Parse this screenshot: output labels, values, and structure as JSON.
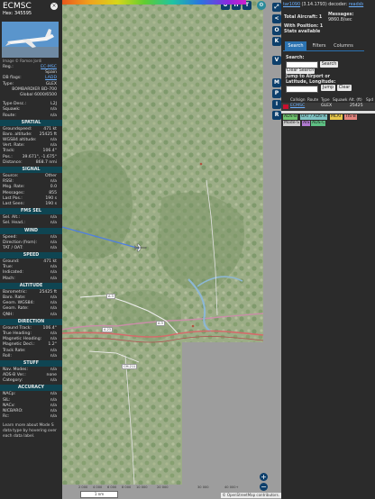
{
  "left_panel": {
    "registration": "ECMSC",
    "hex_line": "Hex: 345595",
    "photo_credit": "Image © Ramon Jordi",
    "close_label": "×",
    "ident_rows": [
      {
        "k": "Reg.:",
        "v": "EC-MSC",
        "link": true
      },
      {
        "k": "",
        "v": "Spain",
        "link": false
      },
      {
        "k": "DB flags:",
        "v": "LADD",
        "link": true
      },
      {
        "k": "Type:",
        "v": "GLEX",
        "link": false
      },
      {
        "k": "",
        "v": "BOMBARDIER BD-700",
        "link": false
      },
      {
        "k": "",
        "v": "Global 6000/6500",
        "link": false
      }
    ],
    "misc_rows": [
      {
        "k": "Type Desc.:",
        "v": "L2J"
      },
      {
        "k": "Squawk:",
        "v": "n/a"
      },
      {
        "k": "Route:",
        "v": "n/a"
      }
    ],
    "sections": [
      {
        "title": "SPATIAL",
        "rows": [
          {
            "k": "Groundspeed:",
            "v": "471 kt"
          },
          {
            "k": "Baro. altitude:",
            "v": "25425 ft"
          },
          {
            "k": "WGS84 altitude:",
            "v": "n/a"
          },
          {
            "k": "Vert. Rate:",
            "v": "n/a"
          },
          {
            "k": "Track:",
            "v": "106.4°"
          },
          {
            "k": "Pos.:",
            "v": "39.671°, -1.675°"
          },
          {
            "k": "Distance:",
            "v": "868.7 nmi"
          }
        ]
      },
      {
        "title": "SIGNAL",
        "rows": [
          {
            "k": "Source:",
            "v": "Other"
          },
          {
            "k": "RSSI:",
            "v": "n/a"
          },
          {
            "k": "Msg. Rate:",
            "v": "0.0"
          },
          {
            "k": "Messages:",
            "v": "855"
          },
          {
            "k": "Last Pos.:",
            "v": "190 s"
          },
          {
            "k": "Last Seen:",
            "v": "190 s"
          }
        ]
      },
      {
        "title": "FMS SEL",
        "rows": [
          {
            "k": "Sel. Alt.:",
            "v": "n/a"
          },
          {
            "k": "Sel. Head.:",
            "v": "n/a"
          }
        ]
      },
      {
        "title": "WIND",
        "rows": [
          {
            "k": "Speed:",
            "v": "n/a"
          },
          {
            "k": "Direction (from):",
            "v": "n/a"
          },
          {
            "k": "TAT / OAT:",
            "v": "n/a"
          }
        ]
      },
      {
        "title": "SPEED",
        "rows": [
          {
            "k": "Ground:",
            "v": "471 kt"
          },
          {
            "k": "True:",
            "v": "n/a"
          },
          {
            "k": "Indicated:",
            "v": "n/a"
          },
          {
            "k": "Mach:",
            "v": "n/a"
          }
        ]
      },
      {
        "title": "ALTITUDE",
        "rows": [
          {
            "k": "Barometric:",
            "v": "25425 ft"
          },
          {
            "k": "Baro. Rate:",
            "v": "n/a"
          },
          {
            "k": "Geom. WGS84:",
            "v": "n/a"
          },
          {
            "k": "Geom. Rate:",
            "v": "n/a"
          },
          {
            "k": "QNH:",
            "v": "n/a"
          }
        ]
      },
      {
        "title": "DIRECTION",
        "rows": [
          {
            "k": "Ground Track:",
            "v": "106.4°"
          },
          {
            "k": "True Heading:",
            "v": "n/a"
          },
          {
            "k": "Magnetic Heading:",
            "v": "n/a"
          },
          {
            "k": "Magnetic Decl.:",
            "v": "1.2°"
          },
          {
            "k": "Track Rate:",
            "v": "n/a"
          },
          {
            "k": "Roll:",
            "v": "n/a"
          }
        ]
      },
      {
        "title": "STUFF",
        "rows": [
          {
            "k": "Nav. Modes:",
            "v": "n/a"
          },
          {
            "k": "ADS-B Ver.:",
            "v": "none"
          },
          {
            "k": "Category:",
            "v": "n/a"
          }
        ]
      },
      {
        "title": "ACCURACY",
        "rows": [
          {
            "k": "NACp:",
            "v": "n/a"
          },
          {
            "k": "SIL:",
            "v": "n/a"
          },
          {
            "k": "NACv:",
            "v": "n/a"
          },
          {
            "k": "NICBARO:",
            "v": "n/a"
          },
          {
            "k": "Rc:",
            "v": "n/a"
          }
        ]
      }
    ],
    "note": "Learn more about Mode S data type by hovering over each data label."
  },
  "map": {
    "top_buttons": [
      "U",
      "H",
      "T"
    ],
    "side_buttons": [
      "<",
      "O",
      "K",
      "V",
      "M",
      "P",
      "I",
      "R"
    ],
    "zoom_in": "+",
    "zoom_out": "−",
    "scale_label": "1 nm",
    "attribution": "© OpenStreetMap contributors.",
    "altitude_legend": [
      "2 000",
      "4 000",
      "6 000",
      "8 000",
      "10 000",
      "20 000",
      "30 000",
      "40 000+"
    ],
    "town_labels": [
      "A-3",
      "A-3",
      "A-23",
      "CM-211"
    ]
  },
  "right_panel": {
    "title_link": "tar1090",
    "version": "(3.14.1793)",
    "decoder_prefix": "decoder:",
    "decoder_link": "readsb",
    "total_aircraft": "Total Aircraft: 1",
    "with_position": "With Position: 1",
    "stats_available": "Stats available",
    "messages_label": "Messages:",
    "messages_rate": "9860.8/sec",
    "tabs": [
      "Search",
      "Filters",
      "Columns"
    ],
    "search_label": "Search:",
    "search_button": "Search",
    "clear_search_button": "Clear Search",
    "jump_label": "Jump to Airport or Latitude, Longitude:",
    "jump_button": "Jump",
    "clear_button": "Clear",
    "table_headers": [
      "Callsign",
      "Route",
      "Type",
      "Squawk",
      "Alt. (ft)",
      "Spd"
    ],
    "table_row": {
      "flag": "ES",
      "callsign": "ECMSC",
      "type": "GLEX",
      "alt": "25425"
    },
    "source_badges": [
      "ADS-B",
      "UAT / ADS-R",
      "MLAT",
      "TIS-B",
      "Mode-S",
      "AIS",
      "ADS-C"
    ],
    "colors": {
      "adsb": "#6fc36f",
      "uat": "#7fc2c2",
      "mlat": "#e6c64a",
      "tisb": "#e4847e",
      "modes": "#cccccc",
      "ais": "#b07ad0",
      "adsc": "#5ec083"
    }
  }
}
